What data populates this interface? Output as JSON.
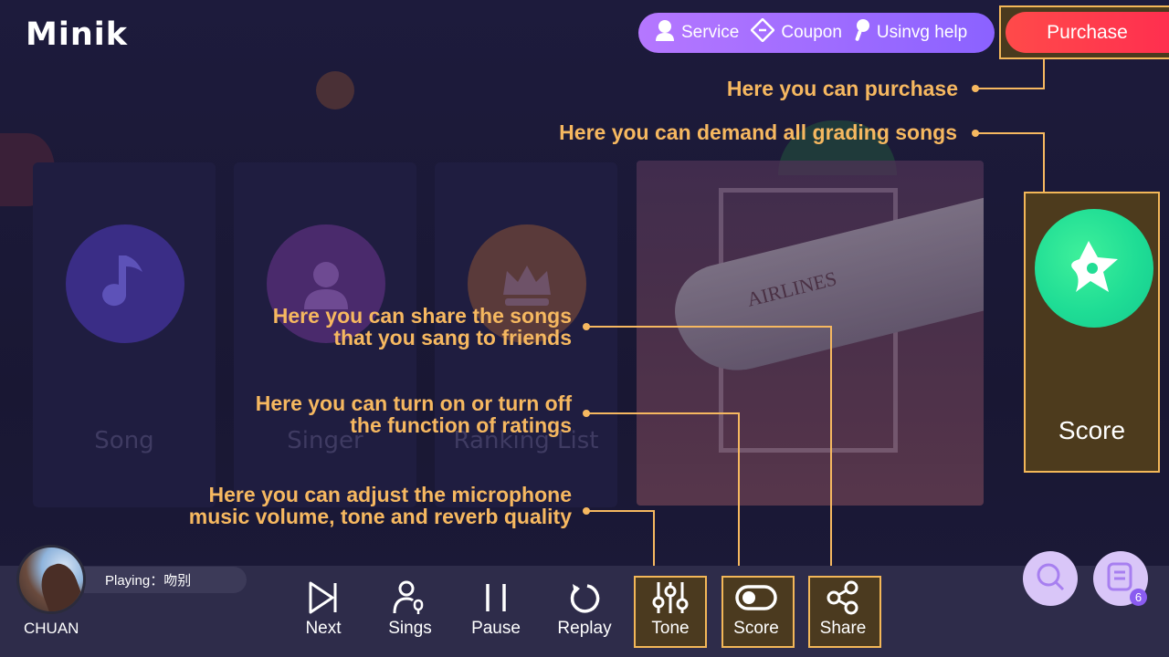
{
  "app": {
    "logo": "Minik"
  },
  "header": {
    "service_label": "Service",
    "coupon_label": "Coupon",
    "help_label": "Usinvg help",
    "purchase_label": "Purchase"
  },
  "background": {
    "cards": [
      {
        "label": "Song",
        "icon": "music-note-icon",
        "color": "#3d2e8a"
      },
      {
        "label": "Singer",
        "icon": "person-icon",
        "color": "#4a2a6a"
      },
      {
        "label": "Ranking List",
        "icon": "crown-icon",
        "color": "#5a3a3c"
      }
    ],
    "cover_text": "AIRLINES"
  },
  "annotations": {
    "purchase": "Here you can purchase",
    "grading": "Here you can demand all grading songs",
    "share_line1": "Here you can share the songs",
    "share_line2": "that you sang to friends",
    "ratings_line1": "Here you can turn on or turn off",
    "ratings_line2": "the function of ratings",
    "adjust_line1": "Here you can adjust the microphone",
    "adjust_line2": "music volume, tone and reverb quality"
  },
  "score_panel": {
    "label": "Score",
    "icon": "star-icon"
  },
  "player": {
    "user_name": "CHUAN",
    "now_playing": "Playing：吻别"
  },
  "controls": {
    "next": "Next",
    "sings": "Sings",
    "pause": "Pause",
    "replay": "Replay",
    "tone": "Tone",
    "score": "Score",
    "share": "Share"
  },
  "queue_count": "6",
  "colors": {
    "accent": "#f6b860",
    "pill": "#9b6cff",
    "purchase": "#ff3b4e",
    "score_green": "#22dd95"
  }
}
